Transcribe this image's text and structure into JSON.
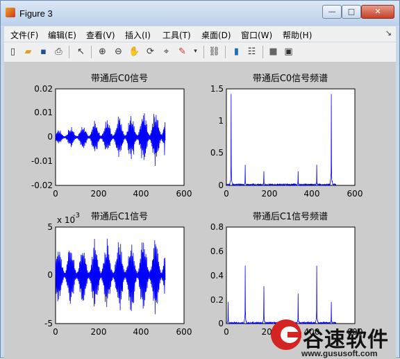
{
  "window": {
    "title": "Figure 3",
    "minimize": "—",
    "maximize": "□",
    "close": "✕"
  },
  "menu": [
    "文件(F)",
    "编辑(E)",
    "查看(V)",
    "插入(I)",
    "工具(T)",
    "桌面(D)",
    "窗口(W)",
    "帮助(H)"
  ],
  "toolbar": {
    "buttons": [
      "new-figure",
      "open-file",
      "save",
      "print",
      "select-arrow",
      "zoom-in",
      "zoom-out",
      "pan-hand",
      "rotate-3d",
      "data-cursor",
      "brush",
      "link",
      "colorbar",
      "legend",
      "hide-plot-tools",
      "show-plot-tools"
    ]
  },
  "plots": [
    {
      "title": "带通后C0信号",
      "yticks": [
        "0.02",
        "0.01",
        "0",
        "-0.01",
        "-0.02"
      ],
      "xticks": [
        "0",
        "200",
        "400",
        "600"
      ],
      "exponent": ""
    },
    {
      "title": "带通后C0信号频谱",
      "yticks": [
        "1.5",
        "1",
        "0.5",
        "0"
      ],
      "xticks": [
        "0",
        "200",
        "400",
        "600"
      ],
      "exponent": ""
    },
    {
      "title": "带通后C1信号",
      "yticks": [
        "5",
        "0",
        "-5"
      ],
      "xticks": [
        "0",
        "200",
        "400",
        "600"
      ],
      "exponent": "x 10",
      "exponent_power": "-3"
    },
    {
      "title": "带通后C1信号频谱",
      "yticks": [
        "0.8",
        "0.6",
        "0.4",
        "0.2",
        "0"
      ],
      "xticks": [
        "0",
        "200",
        "400",
        "600"
      ],
      "exponent": ""
    }
  ],
  "chart_data": [
    {
      "type": "line",
      "title": "带通后C0信号",
      "xlim": [
        0,
        600
      ],
      "ylim": [
        -0.02,
        0.02
      ],
      "series": [
        {
          "x_range": [
            0,
            512
          ],
          "amplitude_envelope": [
            0.003,
            0.014
          ],
          "color": "#0000ff"
        }
      ]
    },
    {
      "type": "line",
      "title": "带通后C0信号频谱",
      "xlim": [
        0,
        600
      ],
      "ylim": [
        0,
        1.5
      ],
      "series": [
        {
          "x_range": [
            0,
            512
          ],
          "peaks": [
            [
              22,
              1.42
            ],
            [
              88,
              0.32
            ],
            [
              175,
              0.22
            ],
            [
              335,
              0.22
            ],
            [
              422,
              0.32
            ],
            [
              490,
              1.42
            ]
          ],
          "color": "#0000ff"
        }
      ]
    },
    {
      "type": "line",
      "title": "带通后C1信号",
      "xlim": [
        0,
        600
      ],
      "ylim": [
        -5,
        5
      ],
      "y_multiplier": "x 10^-3",
      "series": [
        {
          "x_range": [
            0,
            512
          ],
          "amplitude_envelope": [
            3.5,
            4.5
          ],
          "color": "#0000ff"
        }
      ]
    },
    {
      "type": "line",
      "title": "带通后C1信号频谱",
      "xlim": [
        0,
        600
      ],
      "ylim": [
        0,
        0.8
      ],
      "series": [
        {
          "x_range": [
            0,
            512
          ],
          "peaks": [
            [
              8,
              0.18
            ],
            [
              88,
              0.48
            ],
            [
              175,
              0.31
            ],
            [
              335,
              0.25
            ],
            [
              422,
              0.48
            ],
            [
              490,
              0.18
            ]
          ],
          "color": "#0000ff"
        }
      ]
    }
  ],
  "watermark": {
    "brand": "谷速软件",
    "url": "www.gususoft.com"
  }
}
